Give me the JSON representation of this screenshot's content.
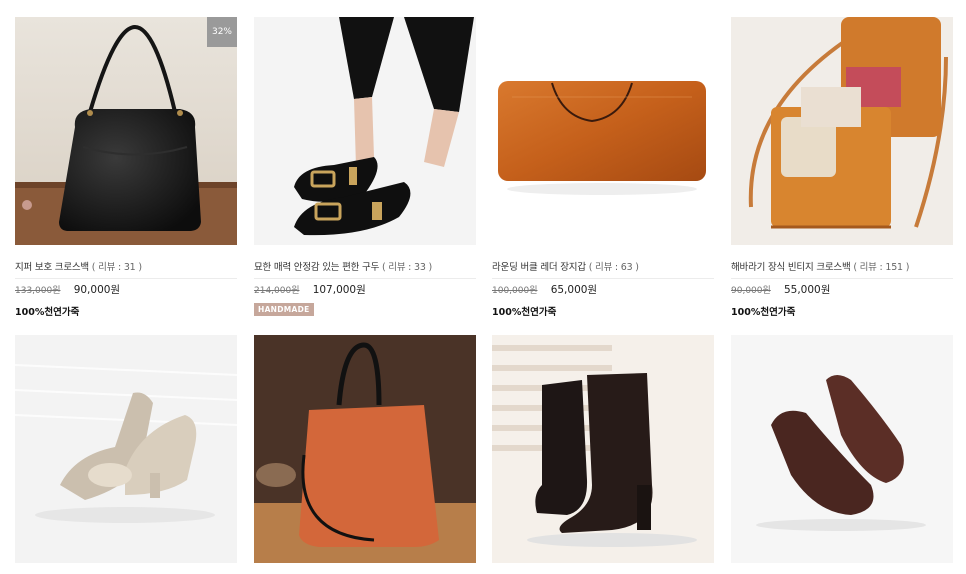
{
  "products": [
    {
      "name": "지퍼 보호 크로스백",
      "review_text": "( 리뷰 : 31 )",
      "old_price": "133,000원",
      "price": "90,000원",
      "badge": "32%",
      "tag": "100%천연가죽",
      "tag_type": "natural",
      "thumb_icon": "black-hobo-bag"
    },
    {
      "name": "묘한 매력 안정감 있는 편한 구두",
      "review_text": "( 리뷰 : 33 )",
      "old_price": "214,000원",
      "price": "107,000원",
      "tag": "HANDMADE",
      "tag_type": "handmade",
      "thumb_icon": "black-heels"
    },
    {
      "name": "라운딩 버클 레더 장지갑",
      "review_text": "( 리뷰 : 63 )",
      "old_price": "100,000원",
      "price": "65,000원",
      "tag": "100%천연가죽",
      "tag_type": "natural",
      "thumb_icon": "orange-long-wallet"
    },
    {
      "name": "해바라기 장식 빈티지 크로스백",
      "review_text": "( 리뷰 : 151 )",
      "old_price": "90,000원",
      "price": "55,000원",
      "tag": "100%천연가죽",
      "tag_type": "natural",
      "thumb_icon": "phone-crossbag"
    },
    {
      "thumb_icon": "silver-ruffle-heels"
    },
    {
      "thumb_icon": "orange-tote-bag"
    },
    {
      "thumb_icon": "black-ankle-boots"
    },
    {
      "thumb_icon": "burgundy-flats"
    }
  ],
  "colors": {
    "accent_tag": "#c6a79b",
    "sale_badge": "#9a9a9a"
  }
}
